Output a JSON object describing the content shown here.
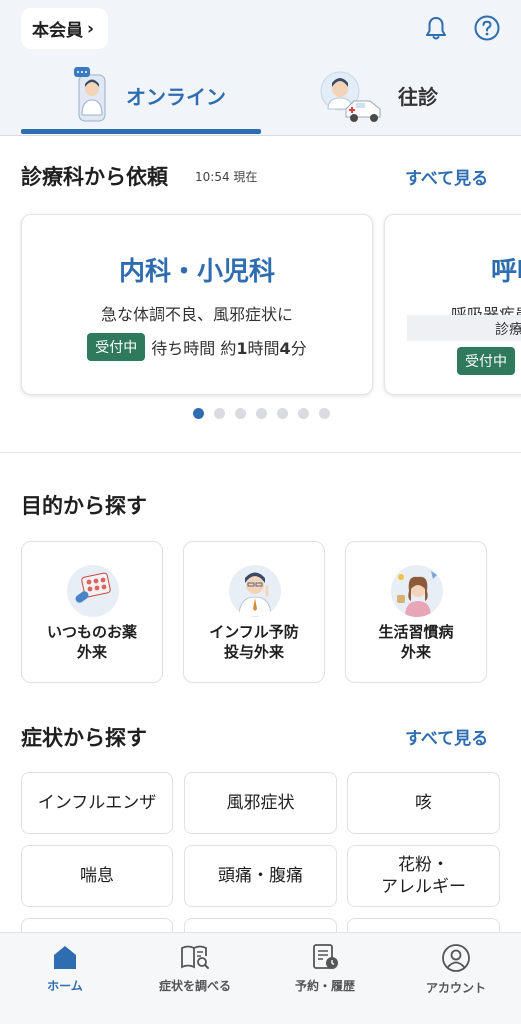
{
  "header": {
    "member_label": "本会員",
    "member_chevron": "›",
    "icons": [
      "bell-icon",
      "help-icon"
    ]
  },
  "tabs": [
    {
      "label": "オンライン",
      "active": true
    },
    {
      "label": "往診",
      "active": false
    }
  ],
  "department_section": {
    "title": "診療科から依頼",
    "timestamp": "10:54 現在",
    "see_all": "すべて見る",
    "cards": [
      {
        "name": "内科・小児科",
        "description": "急な体調不良、風邪症状に",
        "status": "受付中",
        "wait_prefix": "待ち時間 約",
        "wait_hours": "1",
        "wait_mid": "時間",
        "wait_minutes": "4",
        "wait_suffix": "分"
      },
      {
        "name": "呼吸",
        "description": "呼吸器疾患",
        "note": "診療",
        "status": "受付中"
      }
    ],
    "pagination": {
      "total": 7,
      "current": 1
    }
  },
  "purpose_section": {
    "title": "目的から探す",
    "items": [
      {
        "label": "いつものお薬\n外来",
        "icon": "medicine-icon"
      },
      {
        "label": "インフル予防\n投与外来",
        "icon": "doctor-icon"
      },
      {
        "label": "生活習慣病\n外来",
        "icon": "lifestyle-icon"
      }
    ]
  },
  "symptom_section": {
    "title": "症状から探す",
    "see_all": "すべて見る",
    "items": [
      "インフルエンザ",
      "風邪症状",
      "咳",
      "喘息",
      "頭痛・腹痛",
      "花粉・\nアレルギー",
      "",
      "",
      ""
    ]
  },
  "bottom_nav": [
    {
      "label": "ホーム",
      "icon": "home-icon",
      "active": true
    },
    {
      "label": "症状を調べる",
      "icon": "book-search-icon",
      "active": false
    },
    {
      "label": "予約・履歴",
      "icon": "history-icon",
      "active": false
    },
    {
      "label": "アカウント",
      "icon": "account-icon",
      "active": false
    }
  ],
  "colors": {
    "primary": "#2f6db1",
    "badge_green": "#2f7a5c",
    "header_bg": "#f1f4f8"
  }
}
